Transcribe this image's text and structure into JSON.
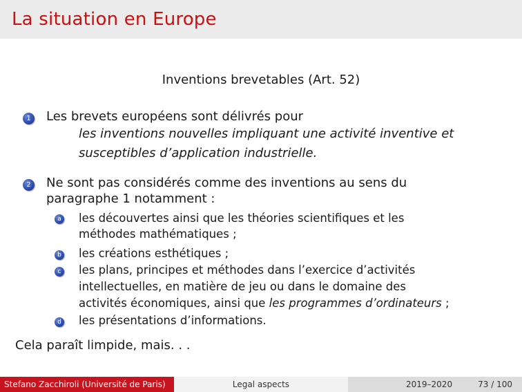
{
  "title": "La situation en Europe",
  "subtitle": "Inventions brevetables (Art. 52)",
  "items": [
    {
      "num": "1",
      "line1": "Les brevets européens sont délivrés pour",
      "quote1": "les inventions nouvelles impliquant une activité inventive et",
      "quote2": "susceptibles d’application industrielle."
    },
    {
      "num": "2",
      "line1": "Ne sont pas considérés comme des inventions au sens du",
      "line2": "paragraphe 1 notamment :",
      "subitems": [
        {
          "letter": "a",
          "line1": "les découvertes ainsi que les théories scientifiques et les",
          "line2": "méthodes mathématiques ;"
        },
        {
          "letter": "b",
          "line1": "les créations esthétiques ;"
        },
        {
          "letter": "c",
          "line1": "les plans, principes et méthodes dans l’exercice d’activités",
          "line2": "intellectuelles, en matière de jeu ou dans le domaine des",
          "line3a": "activités économiques, ainsi que ",
          "line3b": "les programmes d’ordinateurs",
          "line3c": " ;"
        },
        {
          "letter": "d",
          "line1": "les présentations d’informations."
        }
      ]
    }
  ],
  "conclusion": "Cela paraît limpide, mais. . .",
  "footer": {
    "author": "Stefano Zacchiroli (Université de Paris)",
    "topic": "Legal aspects",
    "year": "2019–2020",
    "page": "73 / 100"
  },
  "colors": {
    "title": "#cc1010",
    "bullet": "#2f4fb4",
    "footer_left": "#c8141e"
  }
}
